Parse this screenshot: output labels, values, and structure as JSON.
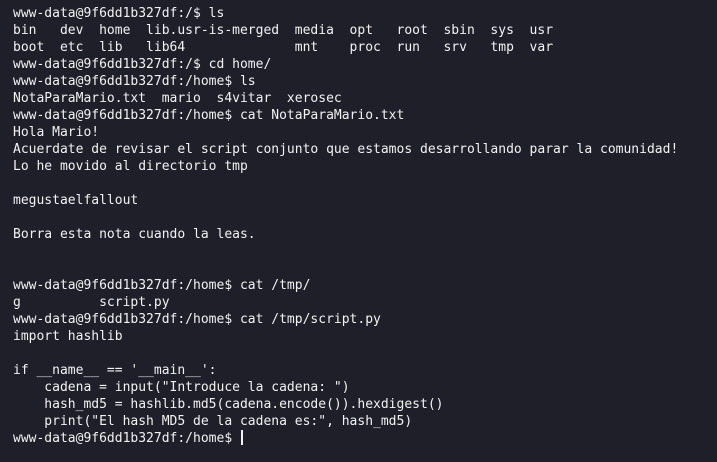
{
  "terminal": {
    "lines": [
      "www-data@9f6dd1b327df:/$ ls",
      "bin   dev  home  lib.usr-is-merged  media  opt   root  sbin  sys  usr",
      "boot  etc  lib   lib64              mnt    proc  run   srv   tmp  var",
      "www-data@9f6dd1b327df:/$ cd home/",
      "www-data@9f6dd1b327df:/home$ ls",
      "NotaParaMario.txt  mario  s4vitar  xerosec",
      "www-data@9f6dd1b327df:/home$ cat NotaParaMario.txt",
      "Hola Mario!",
      "Acuerdate de revisar el script conjunto que estamos desarrollando parar la comunidad!",
      "Lo he movido al directorio tmp",
      "",
      "megustaelfallout",
      "",
      "Borra esta nota cuando la leas.",
      "",
      "",
      "www-data@9f6dd1b327df:/home$ cat /tmp/",
      "g          script.py",
      "www-data@9f6dd1b327df:/home$ cat /tmp/script.py",
      "import hashlib",
      "",
      "if __name__ == '__main__':",
      "    cadena = input(\"Introduce la cadena: \")",
      "    hash_md5 = hashlib.md5(cadena.encode()).hexdigest()",
      "    print(\"El hash MD5 de la cadena es:\", hash_md5)"
    ],
    "prompt": "www-data@9f6dd1b327df:/home$ "
  },
  "colors": {
    "background": "#1e1f29",
    "foreground": "#f2f2f2"
  }
}
